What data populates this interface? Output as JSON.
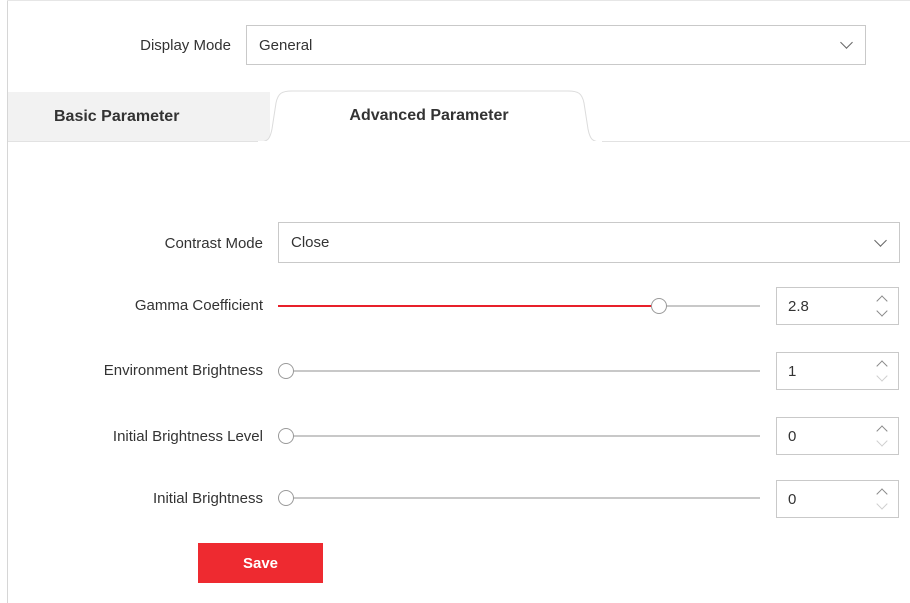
{
  "display_mode": {
    "label": "Display Mode",
    "value": "General"
  },
  "tabs": [
    {
      "label": "Basic Parameter",
      "active": false
    },
    {
      "label": "Advanced Parameter",
      "active": true
    }
  ],
  "contrast_mode": {
    "label": "Contrast Mode",
    "value": "Close"
  },
  "sliders": [
    {
      "label": "Gamma Coefficient",
      "value": "2.8",
      "fill_fraction": 0.79,
      "up_enabled": true,
      "down_enabled": true
    },
    {
      "label": "Environment Brightness",
      "value": "1",
      "fill_fraction": 0,
      "up_enabled": true,
      "down_enabled": false
    },
    {
      "label": "Initial Brightness Level",
      "value": "0",
      "fill_fraction": 0,
      "up_enabled": true,
      "down_enabled": false
    },
    {
      "label": "Initial Brightness",
      "value": "0",
      "fill_fraction": 0,
      "up_enabled": true,
      "down_enabled": false
    }
  ],
  "save_label": "Save",
  "colors": {
    "accent": "#ee2a30",
    "slider_fill": "#e8202a",
    "tab_inactive_bg": "#f2f2f2"
  }
}
